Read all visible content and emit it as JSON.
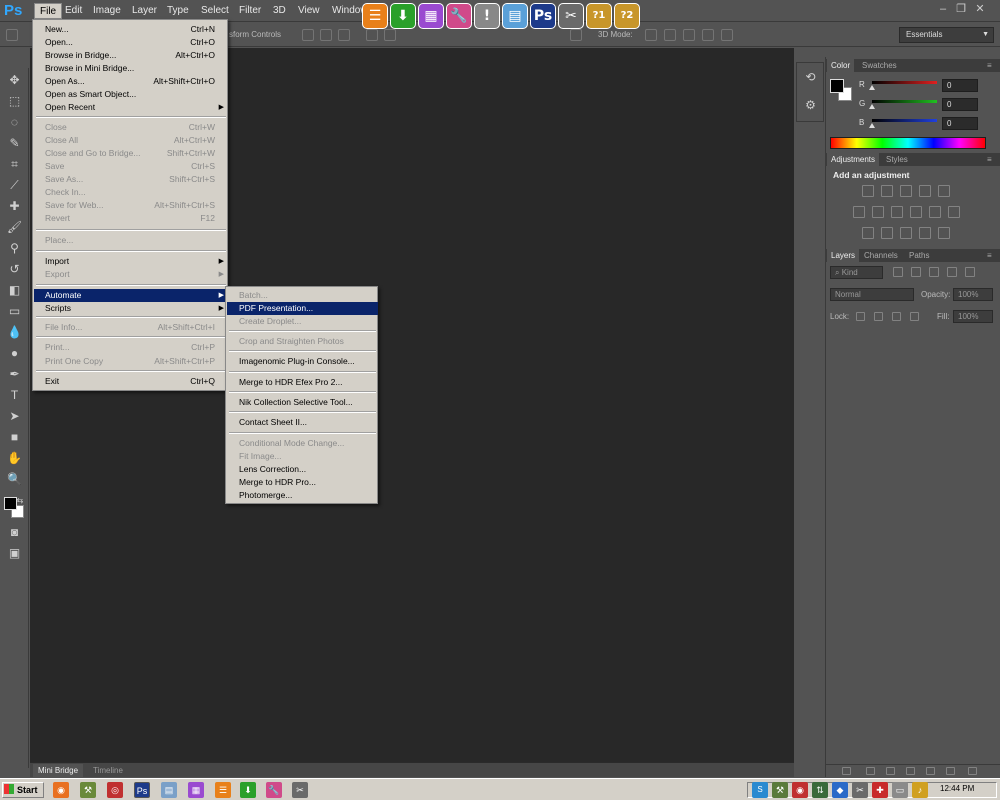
{
  "menubar": {
    "app_logo": "Ps",
    "items": [
      "File",
      "Edit",
      "Image",
      "Layer",
      "Type",
      "Select",
      "Filter",
      "3D",
      "View",
      "Window"
    ],
    "window_controls": [
      "–",
      "❐",
      "✕"
    ]
  },
  "optionsbar": {
    "transform_label": "sform Controls",
    "mode_label": "3D Mode:",
    "workspace": "Essentials"
  },
  "file_menu": [
    {
      "label": "New...",
      "shortcut": "Ctrl+N",
      "disabled": false
    },
    {
      "label": "Open...",
      "shortcut": "Ctrl+O",
      "disabled": false
    },
    {
      "label": "Browse in Bridge...",
      "shortcut": "Alt+Ctrl+O",
      "disabled": false
    },
    {
      "label": "Browse in Mini Bridge...",
      "shortcut": "",
      "disabled": false
    },
    {
      "label": "Open As...",
      "shortcut": "Alt+Shift+Ctrl+O",
      "disabled": false
    },
    {
      "label": "Open as Smart Object...",
      "shortcut": "",
      "disabled": false
    },
    {
      "label": "Open Recent",
      "shortcut": "",
      "disabled": false,
      "submenu": true
    },
    {
      "label": "Close",
      "shortcut": "Ctrl+W",
      "disabled": true
    },
    {
      "label": "Close All",
      "shortcut": "Alt+Ctrl+W",
      "disabled": true
    },
    {
      "label": "Close and Go to Bridge...",
      "shortcut": "Shift+Ctrl+W",
      "disabled": true
    },
    {
      "label": "Save",
      "shortcut": "Ctrl+S",
      "disabled": true
    },
    {
      "label": "Save As...",
      "shortcut": "Shift+Ctrl+S",
      "disabled": true
    },
    {
      "label": "Check In...",
      "shortcut": "",
      "disabled": true
    },
    {
      "label": "Save for Web...",
      "shortcut": "Alt+Shift+Ctrl+S",
      "disabled": true
    },
    {
      "label": "Revert",
      "shortcut": "F12",
      "disabled": true
    },
    {
      "label": "Place...",
      "shortcut": "",
      "disabled": true
    },
    {
      "label": "Import",
      "shortcut": "",
      "disabled": false,
      "submenu": true
    },
    {
      "label": "Export",
      "shortcut": "",
      "disabled": true,
      "submenu": true
    },
    {
      "label": "Automate",
      "shortcut": "",
      "disabled": false,
      "submenu": true,
      "highlighted": true
    },
    {
      "label": "Scripts",
      "shortcut": "",
      "disabled": false,
      "submenu": true
    },
    {
      "label": "File Info...",
      "shortcut": "Alt+Shift+Ctrl+I",
      "disabled": true
    },
    {
      "label": "Print...",
      "shortcut": "Ctrl+P",
      "disabled": true
    },
    {
      "label": "Print One Copy",
      "shortcut": "Alt+Shift+Ctrl+P",
      "disabled": true
    },
    {
      "label": "Exit",
      "shortcut": "Ctrl+Q",
      "disabled": false
    }
  ],
  "automate_menu": [
    {
      "label": "Batch...",
      "disabled": true
    },
    {
      "label": "PDF Presentation...",
      "disabled": false,
      "highlighted": true
    },
    {
      "label": "Create Droplet...",
      "disabled": true
    },
    {
      "label": "Crop and Straighten Photos",
      "disabled": true
    },
    {
      "label": "Imagenomic Plug-in Console...",
      "disabled": false
    },
    {
      "label": "Merge to HDR Efex Pro 2...",
      "disabled": false
    },
    {
      "label": "Nik Collection Selective Tool...",
      "disabled": false
    },
    {
      "label": "Contact Sheet II...",
      "disabled": false
    },
    {
      "label": "Conditional Mode Change...",
      "disabled": true
    },
    {
      "label": "Fit Image...",
      "disabled": true
    },
    {
      "label": "Lens Correction...",
      "disabled": false
    },
    {
      "label": "Merge to HDR Pro...",
      "disabled": false
    },
    {
      "label": "Photomerge...",
      "disabled": false
    }
  ],
  "color_panel": {
    "tabs": [
      "Color",
      "Swatches"
    ],
    "channels": [
      {
        "label": "R",
        "value": "0",
        "color": "#e02020"
      },
      {
        "label": "G",
        "value": "0",
        "color": "#20c020"
      },
      {
        "label": "B",
        "value": "0",
        "color": "#2040e0"
      }
    ]
  },
  "adjustments_panel": {
    "tabs": [
      "Adjustments",
      "Styles"
    ],
    "heading": "Add an adjustment"
  },
  "layers_panel": {
    "tabs": [
      "Layers",
      "Channels",
      "Paths"
    ],
    "kind_filter": "Kind",
    "blend_mode": "Normal",
    "opacity_label": "Opacity:",
    "opacity_value": "100%",
    "lock_label": "Lock:",
    "fill_label": "Fill:",
    "fill_value": "100%"
  },
  "bottom_tabs": [
    "Mini Bridge",
    "Timeline"
  ],
  "taskbar": {
    "start_label": "Start",
    "clock": "12:44 PM"
  },
  "launcher_colors": [
    "#e8801a",
    "#2aa02a",
    "#9a4ad0",
    "#d04a8a",
    "#888888",
    "#5aa0d8",
    "#1d3a8a",
    "#6a6a6a",
    "#c8962a",
    "#c8962a"
  ],
  "launcher_glyphs": [
    "☰",
    "⬇",
    "▦",
    "🔧",
    "!",
    "▤",
    "Ps",
    "✂",
    "?1",
    "?2"
  ]
}
